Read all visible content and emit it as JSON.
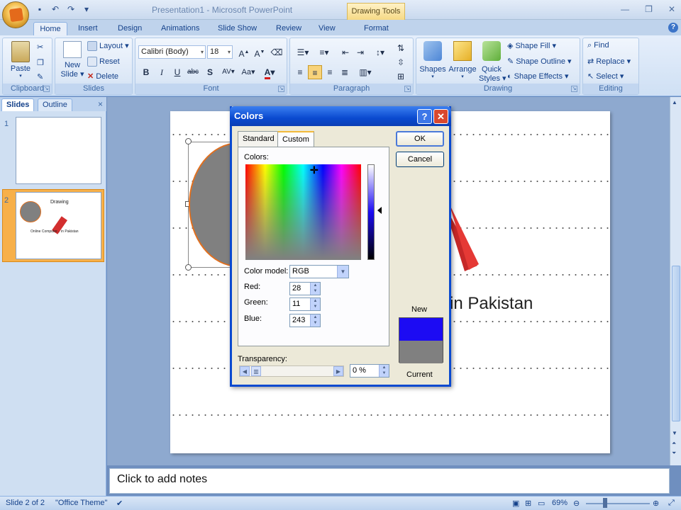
{
  "app": {
    "title": "Presentation1 - Microsoft PowerPoint",
    "contextual_tab_group": "Drawing Tools"
  },
  "ribbon_tabs": [
    "Home",
    "Insert",
    "Design",
    "Animations",
    "Slide Show",
    "Review",
    "View",
    "Format"
  ],
  "active_tab": "Home",
  "ribbon": {
    "clipboard": {
      "label": "Clipboard",
      "paste": "Paste"
    },
    "slides": {
      "label": "Slides",
      "new_slide_line1": "New",
      "new_slide_line2": "Slide",
      "layout": "Layout",
      "reset": "Reset",
      "delete": "Delete"
    },
    "font": {
      "label": "Font",
      "font_name": "Calibri (Body)",
      "font_size": "18",
      "bold": "B",
      "italic": "I",
      "underline": "U",
      "strike": "abc",
      "shadow": "S",
      "spacing": "AV",
      "case": "Aa",
      "color": "A"
    },
    "paragraph": {
      "label": "Paragraph"
    },
    "drawing": {
      "label": "Drawing",
      "shapes": "Shapes",
      "arrange": "Arrange",
      "quick_styles_line1": "Quick",
      "quick_styles_line2": "Styles",
      "shape_fill": "Shape Fill",
      "shape_outline": "Shape Outline",
      "shape_effects": "Shape Effects"
    },
    "editing": {
      "label": "Editing",
      "find": "Find",
      "replace": "Replace",
      "select": "Select"
    }
  },
  "left_panel": {
    "tabs": [
      "Slides",
      "Outline"
    ],
    "close": "×",
    "thumbnails": [
      {
        "number": "1"
      },
      {
        "number": "2",
        "title": "Drawing",
        "caption": "Online Computer... in Pakistan"
      }
    ]
  },
  "slide": {
    "visible_text": "in Pakistan"
  },
  "notes_placeholder": "Click to add notes",
  "status_bar": {
    "slide_position": "Slide 2 of 2",
    "theme": "\"Office Theme\"",
    "zoom": "69%"
  },
  "colors_dialog": {
    "title": "Colors",
    "help": "?",
    "close": "✕",
    "tabs": [
      "Standard",
      "Custom"
    ],
    "active_tab": "Custom",
    "colors_label": "Colors:",
    "color_model_label": "Color model:",
    "color_model": "RGB",
    "red_label": "Red:",
    "red": "28",
    "green_label": "Green:",
    "green": "11",
    "blue_label": "Blue:",
    "blue": "243",
    "transparency_label": "Transparency:",
    "transparency": "0 %",
    "ok": "OK",
    "cancel": "Cancel",
    "new_label": "New",
    "current_label": "Current",
    "new_color": "#1C0BF3",
    "current_color": "#808080"
  },
  "colors": {
    "accent": "#15428B",
    "selected_thumb": "#F7B04A",
    "arrow_red": "#D32F2F",
    "shape_gray": "#808080",
    "shape_outline": "#E07020"
  }
}
